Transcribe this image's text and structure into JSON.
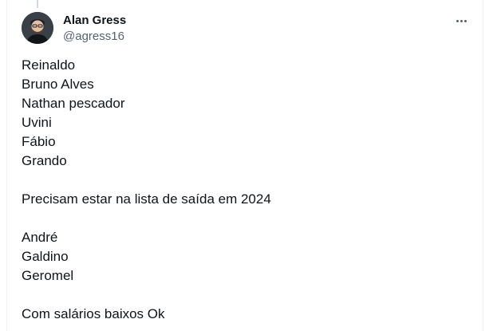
{
  "author": {
    "name": "Alan Gress",
    "handle": "@agress16"
  },
  "icons": {
    "more": "more-horizontal-icon",
    "avatar": "user-avatar"
  },
  "tweet": {
    "block1": [
      "Reinaldo",
      "Bruno Alves",
      "Nathan pescador",
      "Uvini",
      "Fábio",
      "Grando"
    ],
    "statement": "Precisam estar na lista de saída em 2024",
    "block2": [
      "André",
      "Galdino",
      "Geromel"
    ],
    "footer": "Com salários baixos Ok"
  }
}
